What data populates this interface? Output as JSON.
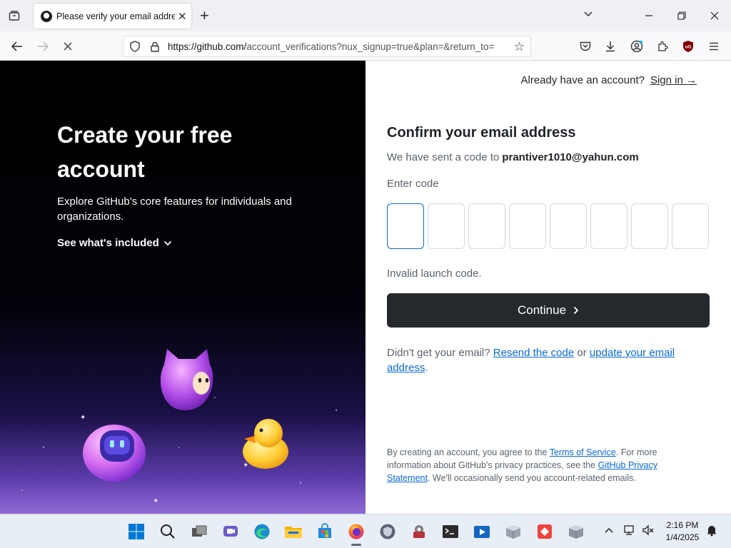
{
  "browser": {
    "tab_title": "Please verify your email address",
    "url_host": "https://github.com/",
    "url_rest": "account_verifications?nux_signup=true&plan=&return_to=",
    "colors": {
      "tabbar": "#f0f0f4",
      "navbar": "#f9f9fb"
    }
  },
  "left_panel": {
    "heading": "Create your free account",
    "subtitle": "Explore GitHub's core features for individuals and organizations.",
    "see_included": "See what's included"
  },
  "right_panel": {
    "already_text": "Already have an account?",
    "sign_in": "Sign in →",
    "title": "Confirm your email address",
    "sent_text": "We have sent a code to",
    "email": "prantiver1010@yahun.com",
    "enter_code_label": "Enter code",
    "code_digits": [
      "",
      "",
      "",
      "",
      "",
      "",
      "",
      ""
    ],
    "invalid_text": "Invalid launch code.",
    "continue_label": "Continue",
    "resend_prefix": "Didn't get your email?",
    "resend_link": "Resend the code",
    "resend_or": "or",
    "update_link": "update your email address",
    "resend_suffix": ".",
    "legal_1": "By creating an account, you agree to the",
    "terms_link": "Terms of Service",
    "legal_2": ". For more information about GitHub's privacy practices, see the",
    "privacy_link": "GitHub Privacy Statement",
    "legal_3": ". We'll occasionally send you account-related emails.",
    "accent": "#0969da",
    "button_color": "#25292e"
  },
  "taskbar": {
    "time": "2:16 PM",
    "date": "1/4/2025"
  }
}
